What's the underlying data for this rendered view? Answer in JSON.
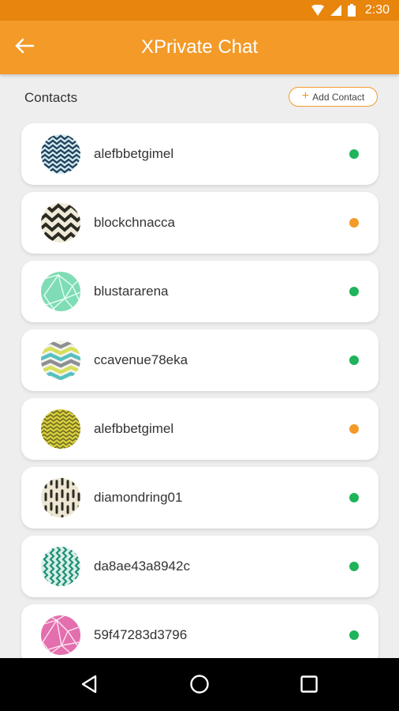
{
  "status_bar": {
    "time": "2:30",
    "icons": [
      "wifi-icon",
      "signal-icon",
      "battery-icon"
    ]
  },
  "app_bar": {
    "title": "XPrivate Chat",
    "back_icon": "arrow-left-icon",
    "background_color": "#f39a28"
  },
  "contacts_section": {
    "title": "Contacts",
    "add_button": {
      "label": "Add Contact",
      "icon": "plus-icon"
    }
  },
  "status_colors": {
    "online": "#1fb35a",
    "away": "#f39a28"
  },
  "contacts": [
    {
      "name": "alefbbetgimel",
      "status": "online",
      "avatar_pattern": "navy-teal zigzag"
    },
    {
      "name": "blockchnacca",
      "status": "away",
      "avatar_pattern": "black-beige chevron"
    },
    {
      "name": "blustararena",
      "status": "online",
      "avatar_pattern": "mint geometric triangles"
    },
    {
      "name": "ccavenue78eka",
      "status": "online",
      "avatar_pattern": "gray-yellow-teal chevron"
    },
    {
      "name": "alefbbetgimel",
      "status": "away",
      "avatar_pattern": "olive-yellow zigzag"
    },
    {
      "name": "diamondring01",
      "status": "online",
      "avatar_pattern": "black-beige dashes"
    },
    {
      "name": "da8ae43a8942c",
      "status": "online",
      "avatar_pattern": "teal zigzag"
    },
    {
      "name": "59f47283d3796",
      "status": "online",
      "avatar_pattern": "pink geometric lines"
    }
  ],
  "nav_bar": {
    "buttons": [
      "back-triangle-icon",
      "home-circle-icon",
      "recents-square-icon"
    ]
  }
}
